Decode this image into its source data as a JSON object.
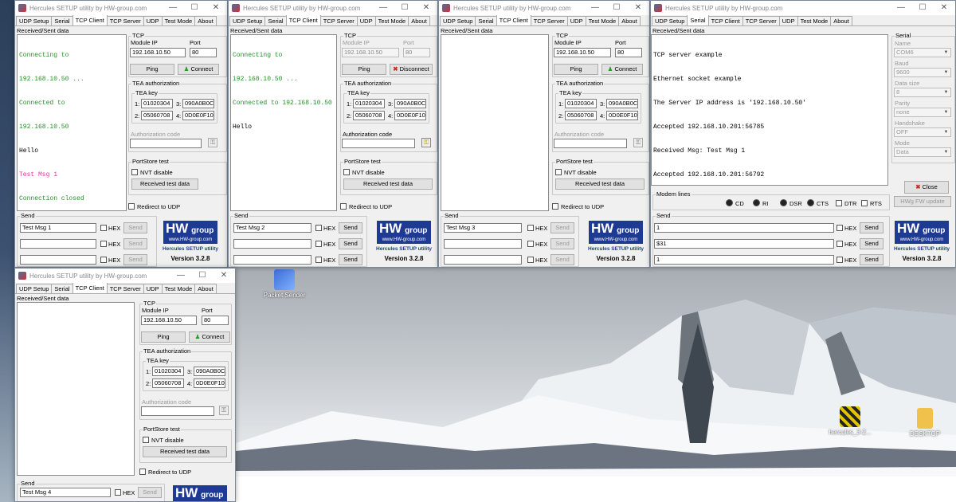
{
  "app_title": "Hercules SETUP utility by HW-group.com",
  "window_controls": {
    "minimize": "—",
    "maximize": "☐",
    "close": "✕"
  },
  "tabs": [
    "UDP Setup",
    "Serial",
    "TCP Client",
    "TCP Server",
    "UDP",
    "Test Mode",
    "About"
  ],
  "labels": {
    "received_sent": "Received/Sent data",
    "tcp": "TCP",
    "module_ip": "Module IP",
    "port": "Port",
    "tea_authorization": "TEA authorization",
    "tea_key": "TEA key",
    "authorization_code": "Authorization code",
    "portstore_test": "PortStore test",
    "nvt_disable": "NVT disable",
    "received_test_data": "Received test data",
    "redirect_to_udp": "Redirect to UDP",
    "send": "Send",
    "hex": "HEX",
    "ping": "Ping",
    "connect": "Connect",
    "disconnect": "Disconnect",
    "key_nums": [
      "1:",
      "2:",
      "3:",
      "4:"
    ]
  },
  "tea_keys": [
    "01020304",
    "05060708",
    "090A0B0C",
    "0D0E0F10"
  ],
  "logo": {
    "brand": "HW",
    "group": "group",
    "url": "www.HW-group.com",
    "subtitle": "Hercules SETUP utility",
    "version": "Version  3.2.8"
  },
  "client1": {
    "log": [
      {
        "text": "Connecting to",
        "color": "#2e8b2e"
      },
      {
        "text": "192.168.10.50 ...",
        "color": "#2e8b2e"
      },
      {
        "text": "Connected to",
        "color": "#2e8b2e"
      },
      {
        "text": "192.168.10.50",
        "color": "#2e8b2e"
      },
      {
        "text": "Hello",
        "color": "#000000"
      },
      {
        "text": "Test Msg 1",
        "color": "#e0399a"
      },
      {
        "text": "Connection closed",
        "color": "#2e8b2e"
      }
    ],
    "module_ip": "192.168.10.50",
    "port": "80",
    "send_values": [
      "Test Msg 1",
      "",
      ""
    ]
  },
  "client2": {
    "log": [
      {
        "text": "Connecting to",
        "color": "#2e8b2e"
      },
      {
        "text": "192.168.10.50 ...",
        "color": "#2e8b2e"
      },
      {
        "text": "Connected to 192.168.10.50",
        "color": "#2e8b2e"
      },
      {
        "text": "Hello",
        "color": "#000000"
      }
    ],
    "module_ip": "192.168.10.50",
    "port": "80",
    "send_values": [
      "Test Msg 2",
      "",
      ""
    ]
  },
  "client3": {
    "module_ip": "192.168.10.50",
    "port": "80",
    "send_values": [
      "Test Msg 3",
      "",
      ""
    ]
  },
  "client4": {
    "module_ip": "192.168.10.50",
    "port": "80",
    "send_values": [
      "Test Msg 4"
    ]
  },
  "serial_win": {
    "log": [
      "TCP server example",
      "Ethernet socket example",
      "The Server IP address is '192.168.10.50'",
      "Accepted 192.168.10.201:56785",
      "Received Msg: Test Msg 1",
      "Accepted 192.168.10.201:56792"
    ],
    "serial_title": "Serial",
    "name_label": "Name",
    "name_value": "COM6",
    "baud_label": "Baud",
    "baud_value": "9600",
    "data_size_label": "Data size",
    "data_size_value": "8",
    "parity_label": "Parity",
    "parity_value": "none",
    "handshake_label": "Handshake",
    "handshake_value": "OFF",
    "mode_label": "Mode",
    "mode_value": "Data",
    "close_label": "Close",
    "hwg_update": "HWg FW update",
    "modem_lines": "Modem lines",
    "signals": [
      "CD",
      "RI",
      "DSR",
      "CTS",
      "DTR",
      "RTS"
    ],
    "send_values": [
      "1",
      "$31",
      "1"
    ]
  },
  "desktop_icons": [
    {
      "label": "Packet Sender"
    },
    {
      "label": "hercules_3-2..."
    },
    {
      "label": "DESKTOP"
    }
  ],
  "colors": {
    "accent_logo": "#1f3a93",
    "green_text": "#2e8b2e",
    "pink_text": "#e0399a"
  }
}
